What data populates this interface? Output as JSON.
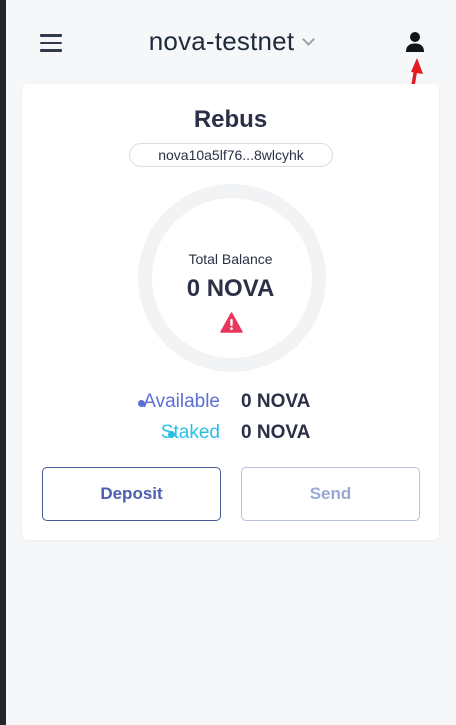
{
  "header": {
    "network_name": "nova-testnet",
    "menu_icon": "hamburger-menu-icon",
    "user_icon": "user-icon"
  },
  "wallet": {
    "name": "Rebus",
    "address": "nova10a5lf76...8wlcyhk"
  },
  "balance": {
    "total_label": "Total Balance",
    "total_value": "0 NOVA",
    "warning_icon": "warning-triangle-icon",
    "available_label": "Available",
    "available_value": "0 NOVA",
    "staked_label": "Staked",
    "staked_value": "0 NOVA"
  },
  "actions": {
    "deposit_label": "Deposit",
    "send_label": "Send"
  },
  "colors": {
    "available": "#5b6fd8",
    "staked": "#29c0e6",
    "warning": "#e8365d",
    "annotation_arrow": "#e31b23"
  }
}
